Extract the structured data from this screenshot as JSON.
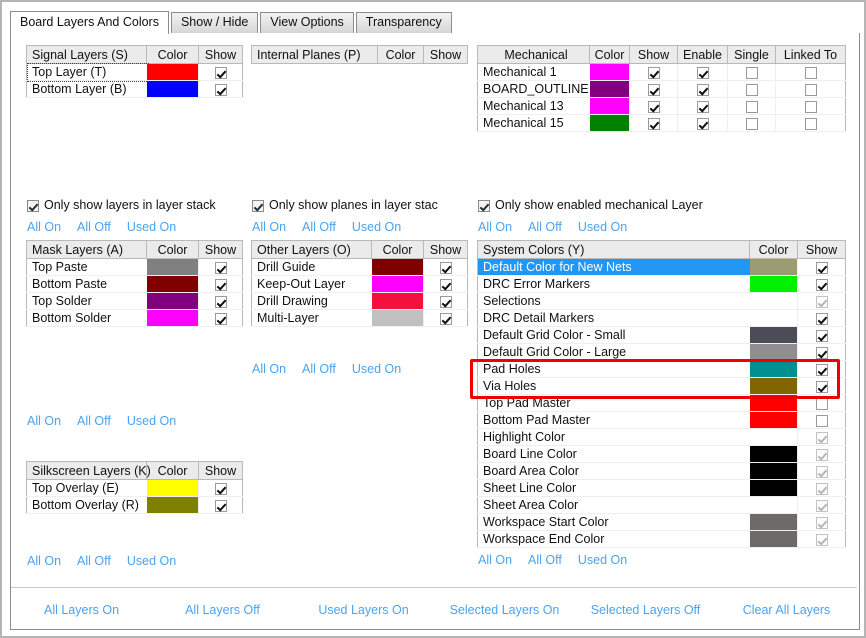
{
  "window": {
    "tabs": [
      {
        "label": "Board Layers And Colors",
        "active": true
      },
      {
        "label": "Show / Hide",
        "active": false
      },
      {
        "label": "View Options",
        "active": false
      },
      {
        "label": "Transparency",
        "active": false
      }
    ]
  },
  "common": {
    "all_on": "All On",
    "all_off": "All Off",
    "used_on": "Used On",
    "col_color": "Color",
    "col_show": "Show"
  },
  "signal_layers": {
    "title": "Signal Layers (S)",
    "rows": [
      {
        "name": "Top Layer (T)",
        "color": "#ff0000",
        "show": true,
        "focused": true
      },
      {
        "name": "Bottom Layer (B)",
        "color": "#0000ff",
        "show": true,
        "focused": false
      }
    ]
  },
  "internal_planes": {
    "title": "Internal Planes (P)",
    "rows": []
  },
  "mechanical": {
    "title": "Mechanical",
    "col_enable": "Enable",
    "col_single": "Single",
    "col_linked": "Linked To",
    "rows": [
      {
        "name": "Mechanical 1",
        "color": "#ff00ff",
        "show": true,
        "enable": true,
        "single": false,
        "linked": false
      },
      {
        "name": "BOARD_OUTLINE",
        "color": "#800080",
        "show": true,
        "enable": true,
        "single": false,
        "linked": false
      },
      {
        "name": "Mechanical 13",
        "color": "#ff00ff",
        "show": true,
        "enable": true,
        "single": false,
        "linked": false
      },
      {
        "name": "Mechanical 15",
        "color": "#008000",
        "show": true,
        "enable": true,
        "single": false,
        "linked": false
      }
    ]
  },
  "options": {
    "only_layers_in_stack": "Only show layers in layer stack",
    "only_planes_in_stack": "Only show planes in layer stac",
    "only_enabled_mechanical": "Only show enabled mechanical Layer"
  },
  "mask_layers": {
    "title": "Mask Layers (A)",
    "rows": [
      {
        "name": "Top Paste",
        "color": "#808080",
        "show": true
      },
      {
        "name": "Bottom Paste",
        "color": "#800000",
        "show": true
      },
      {
        "name": "Top Solder",
        "color": "#800080",
        "show": true
      },
      {
        "name": "Bottom Solder",
        "color": "#ff00ff",
        "show": true
      }
    ]
  },
  "other_layers": {
    "title": "Other Layers (O)",
    "rows": [
      {
        "name": "Drill Guide",
        "color": "#800000",
        "show": true
      },
      {
        "name": "Keep-Out Layer",
        "color": "#ff00ff",
        "show": true
      },
      {
        "name": "Drill Drawing",
        "color": "#f50f3c",
        "show": true
      },
      {
        "name": "Multi-Layer",
        "color": "#c0c0c0",
        "show": true
      }
    ]
  },
  "silkscreen_layers": {
    "title": "Silkscreen Layers (K)",
    "rows": [
      {
        "name": "Top Overlay (E)",
        "color": "#ffff00",
        "show": true
      },
      {
        "name": "Bottom Overlay (R)",
        "color": "#808000",
        "show": true
      }
    ]
  },
  "system_colors": {
    "title": "System Colors (Y)",
    "rows": [
      {
        "name": "Default Color for New Nets",
        "color": "#9c9c72",
        "show": true,
        "enabled": true,
        "selected": true
      },
      {
        "name": "DRC Error Markers",
        "color": "#00f000",
        "show": true,
        "enabled": true,
        "selected": false
      },
      {
        "name": "Selections",
        "color": null,
        "show": true,
        "enabled": false,
        "selected": false
      },
      {
        "name": "DRC Detail Markers",
        "color": null,
        "show": true,
        "enabled": true,
        "selected": false
      },
      {
        "name": "Default Grid Color - Small",
        "color": "#4c4c58",
        "show": true,
        "enabled": true,
        "selected": false
      },
      {
        "name": "Default Grid Color - Large",
        "color": "#918d91",
        "show": true,
        "enabled": true,
        "selected": false
      },
      {
        "name": "Pad Holes",
        "color": "#009090",
        "show": true,
        "enabled": true,
        "selected": false
      },
      {
        "name": "Via Holes",
        "color": "#806600",
        "show": true,
        "enabled": true,
        "selected": false
      },
      {
        "name": "Top Pad Master",
        "color": "#ff0000",
        "show": false,
        "enabled": true,
        "selected": false
      },
      {
        "name": "Bottom Pad Master",
        "color": "#ff0000",
        "show": false,
        "enabled": true,
        "selected": false
      },
      {
        "name": "Highlight Color",
        "color": null,
        "show": true,
        "enabled": false,
        "selected": false
      },
      {
        "name": "Board Line Color",
        "color": "#000000",
        "show": true,
        "enabled": false,
        "selected": false
      },
      {
        "name": "Board Area Color",
        "color": "#000000",
        "show": true,
        "enabled": false,
        "selected": false
      },
      {
        "name": "Sheet Line Color",
        "color": "#000000",
        "show": true,
        "enabled": false,
        "selected": false
      },
      {
        "name": "Sheet Area Color",
        "color": null,
        "show": true,
        "enabled": false,
        "selected": false
      },
      {
        "name": "Workspace Start Color",
        "color": "#6e6a6a",
        "show": true,
        "enabled": false,
        "selected": false
      },
      {
        "name": "Workspace End Color",
        "color": "#6e6a6a",
        "show": true,
        "enabled": false,
        "selected": false
      }
    ]
  },
  "bottom_bar": {
    "links": [
      "All Layers On",
      "All Layers Off",
      "Used Layers On",
      "Selected Layers On",
      "Selected Layers Off",
      "Clear All Layers"
    ]
  },
  "annotations": {
    "highlight_color": "#ee0000",
    "highlight_rows": [
      "Pad Holes",
      "Via Holes"
    ]
  }
}
